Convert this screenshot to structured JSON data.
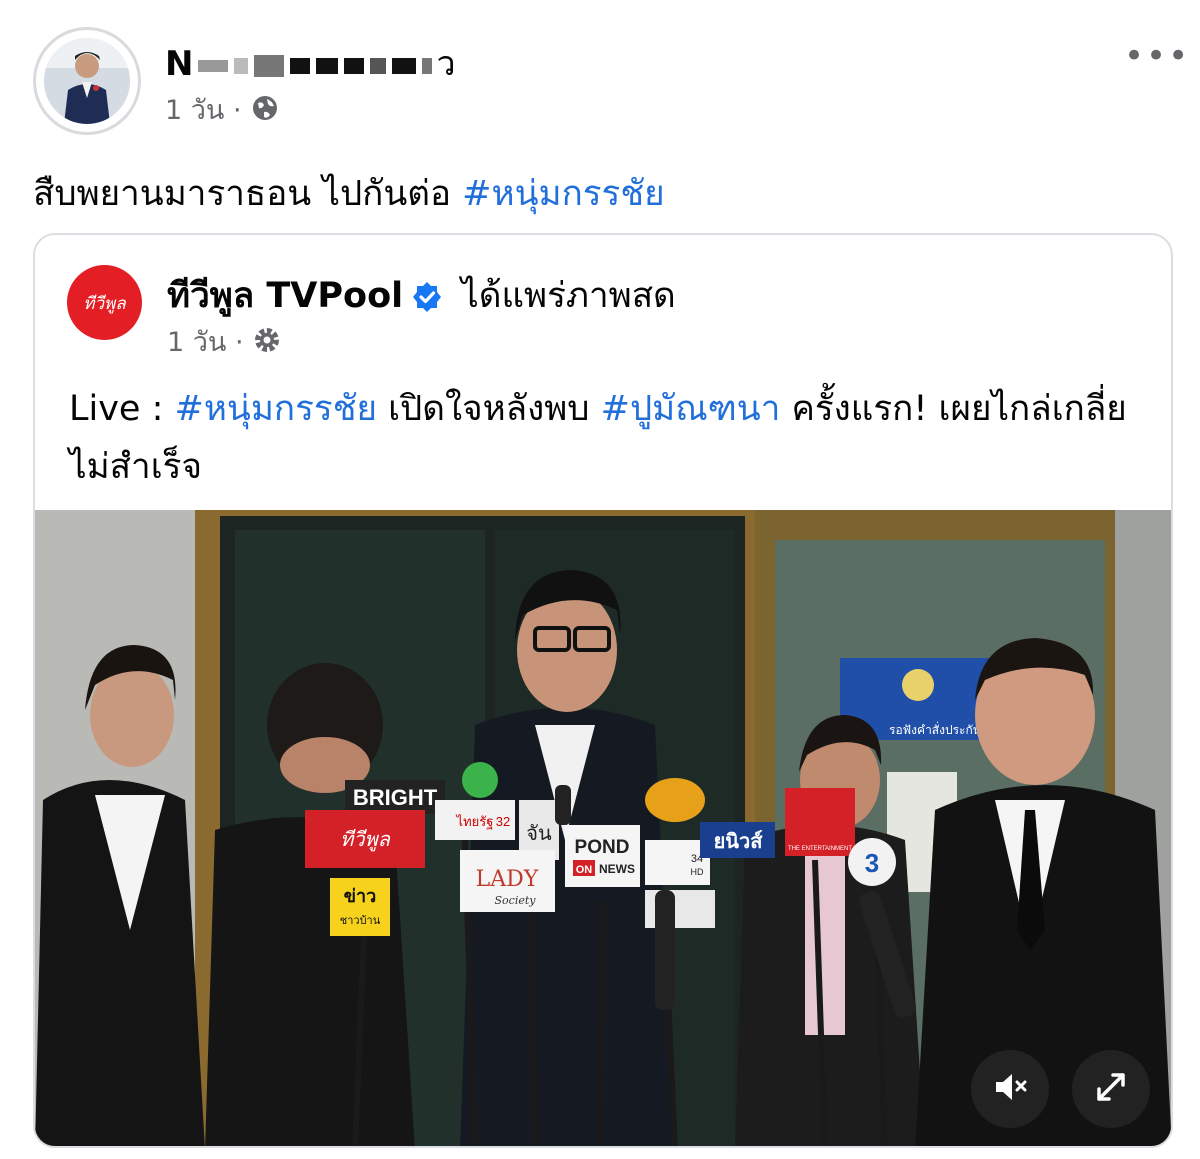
{
  "post": {
    "author": "N",
    "author_suffix": "ว",
    "time": "1 วัน",
    "visibility_icon": "globe-icon",
    "text": "สืบพยานมาราธอน ไปกันต่อ ",
    "hashtag": "#หนุ่มกรรชัย",
    "more_label": "•••"
  },
  "shared": {
    "page_name": "ทีวีพูล TVPool",
    "status": "ได้แพร่ภาพสด",
    "time": "1 วัน",
    "visibility_icon": "gear-icon",
    "text_prefix": "Live : ",
    "hashtag1": "#หนุ่มกรรชัย",
    "text_mid": " เปิดใจหลังพบ ",
    "hashtag2": "#ปูมัณฑนา",
    "text_suffix": " ครั้งแรก! เผยไกล่เกลี่ยไม่สำเร็จ",
    "logo_text": "ทีวีพูล"
  },
  "video": {
    "sign_text": "รอฟังคำสั่งประกัน",
    "mic_labels": {
      "bright": "BRIGHT",
      "tvpool": "ทีวีพูล",
      "khao": "ข่าว",
      "khao_sub": "ชาวบ้าน",
      "lady": "LADY",
      "lady_sub": "Society",
      "pond": "POND",
      "pond_on": "ON",
      "pond_news": "NEWS",
      "thairath": "ไทยรัฐ",
      "thairath_ch": "32",
      "channel34": "34",
      "channel34_hd": "HD",
      "yanews": "ยนิวส์",
      "ent": "THE ENTERTAINMENT",
      "ch3": "3",
      "jan": "จัน"
    },
    "mute_icon": "mute-icon",
    "expand_icon": "expand-icon"
  }
}
